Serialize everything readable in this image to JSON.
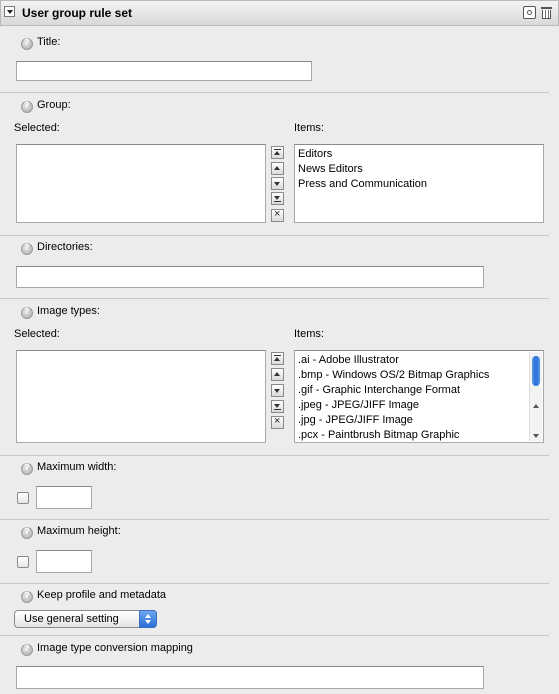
{
  "header": {
    "title": "User group rule set"
  },
  "fields": {
    "title": {
      "label": "Title:",
      "value": ""
    },
    "group": {
      "label": "Group:",
      "selected_label": "Selected:",
      "items_label": "Items:",
      "items": [
        "Editors",
        "News Editors",
        "Press and Communication"
      ]
    },
    "directories": {
      "label": "Directories:",
      "value": ""
    },
    "image_types": {
      "label": "Image types:",
      "selected_label": "Selected:",
      "items_label": "Items:",
      "items": [
        ".ai - Adobe Illustrator",
        ".bmp - Windows OS/2 Bitmap Graphics",
        ".gif - Graphic Interchange Format",
        ".jpeg - JPEG/JIFF Image",
        ".jpg - JPEG/JIFF Image",
        ".pcx - Paintbrush Bitmap Graphic"
      ]
    },
    "max_width": {
      "label": "Maximum width:",
      "value": ""
    },
    "max_height": {
      "label": "Maximum height:",
      "value": ""
    },
    "keep_profile": {
      "label": "Keep profile and metadata",
      "selected": "Use general setting"
    },
    "conversion_mapping": {
      "label": "Image type conversion mapping",
      "value": ""
    }
  }
}
